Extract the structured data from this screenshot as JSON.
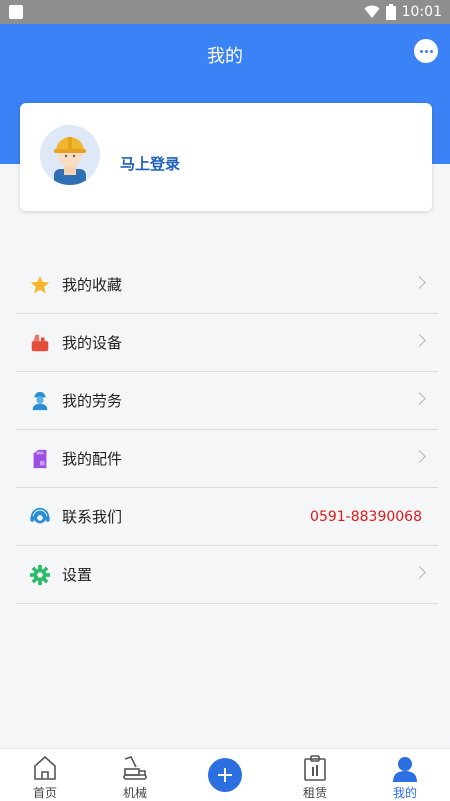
{
  "status_bar": {
    "time": "10:01"
  },
  "header": {
    "title": "我的"
  },
  "profile": {
    "login_text": "马上登录"
  },
  "menu": {
    "items": [
      {
        "label": "我的收藏",
        "icon": "star-icon"
      },
      {
        "label": "我的设备",
        "icon": "equipment-icon"
      },
      {
        "label": "我的劳务",
        "icon": "worker-icon"
      },
      {
        "label": "我的配件",
        "icon": "parts-icon"
      },
      {
        "label": "联系我们",
        "icon": "headset-icon",
        "value": "0591-88390068"
      },
      {
        "label": "设置",
        "icon": "gear-icon"
      }
    ]
  },
  "tabbar": {
    "items": [
      {
        "label": "首页",
        "icon": "home-icon"
      },
      {
        "label": "机械",
        "icon": "machine-icon"
      },
      {
        "label": "",
        "icon": "plus-icon"
      },
      {
        "label": "租赁",
        "icon": "clipboard-icon"
      },
      {
        "label": "我的",
        "icon": "person-icon",
        "active": true
      }
    ]
  },
  "colors": {
    "primary": "#3b82f6",
    "accent_text": "#1f5fbf",
    "phone": "#e01818",
    "active_tab": "#2c6fe0"
  }
}
